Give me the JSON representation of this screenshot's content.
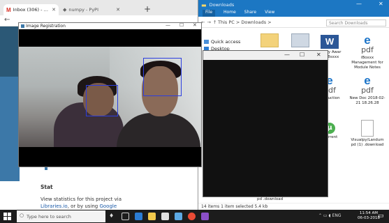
{
  "chrome": {
    "tab_active_label": "Inbox (306) - Update and Statistics",
    "tab_inactive_label": "numpy - PyPI",
    "new_tab": "+",
    "stat_heading": "Stat",
    "stat_text_pre": "View statistics for this project via ",
    "stat_link1": "Libraries.io",
    "stat_text_mid": ", or by using ",
    "stat_link2": "Google BigQuery"
  },
  "explorer": {
    "title": "Downloads",
    "ribbon": [
      "File",
      "Home",
      "Share",
      "View"
    ],
    "path": "This PC  >  Downloads  >",
    "search_placeholder": "Search Downloads",
    "nav_items": [
      "Quick access",
      "Desktop"
    ],
    "files": [
      {
        "name": "Ipsiloy Awar 2018sxxx",
        "icon": "word-icon"
      },
      {
        "name": "iBoxxx Management for Module Notes",
        "icon": "pdf-icon"
      },
      {
        "name": "Production",
        "icon": "pdf-icon"
      },
      {
        "name": "New Doc 2018-02-21 18.26.28",
        "icon": "pdf-icon"
      },
      {
        "name": "uTorrent",
        "icon": "utorrent-icon"
      },
      {
        "name": "Visualpy/Landum pd (1) .download",
        "icon": "file-icon"
      }
    ],
    "partial_label": "pd .download",
    "status": "14 items   1 item selected  5.4 kb"
  },
  "image_window": {
    "title": "Image Registration",
    "minimize": "—",
    "maximize": "☐",
    "close": "✕"
  },
  "black_window": {
    "minimize": "—",
    "maximize": "☐",
    "close": "✕"
  },
  "taskbar": {
    "search_placeholder": "Type here to search",
    "time": "11:54 AM",
    "date": "06-03-2018",
    "tray": "ENG"
  },
  "colors": {
    "face_box": "#2c3ee0",
    "explorer_blue": "#1c77c3",
    "taskbar": "#1c1c1c"
  }
}
